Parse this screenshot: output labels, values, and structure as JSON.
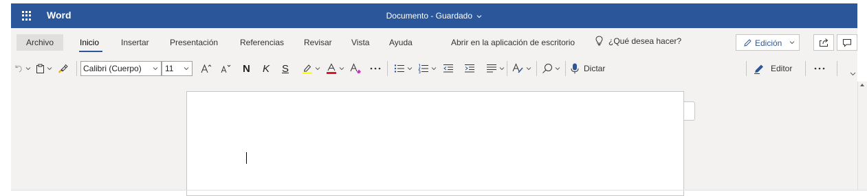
{
  "titlebar": {
    "app_name": "Word",
    "document_title": "Documento - Guardado",
    "brand_color": "#2b579a",
    "icons": [
      "app-launcher-icon",
      "chevron-down-icon"
    ]
  },
  "ribbon": {
    "tabs": [
      "Archivo",
      "Inicio",
      "Insertar",
      "Presentación",
      "Referencias",
      "Revisar",
      "Vista",
      "Ayuda",
      "Abrir en la aplicación de escritorio"
    ],
    "active_tab": "Inicio",
    "search_placeholder": "¿Qué desea hacer?",
    "mode_button": "Edición",
    "toolbar": {
      "font_name": "Calibri (Cuerpo)",
      "font_size": "11",
      "bold_glyph": "N",
      "italic_glyph": "K",
      "underline_glyph": "S",
      "dictate_label": "Dictar",
      "editor_label": "Editor",
      "highlight_color": "#ffff00",
      "font_color": "#e81123"
    }
  }
}
